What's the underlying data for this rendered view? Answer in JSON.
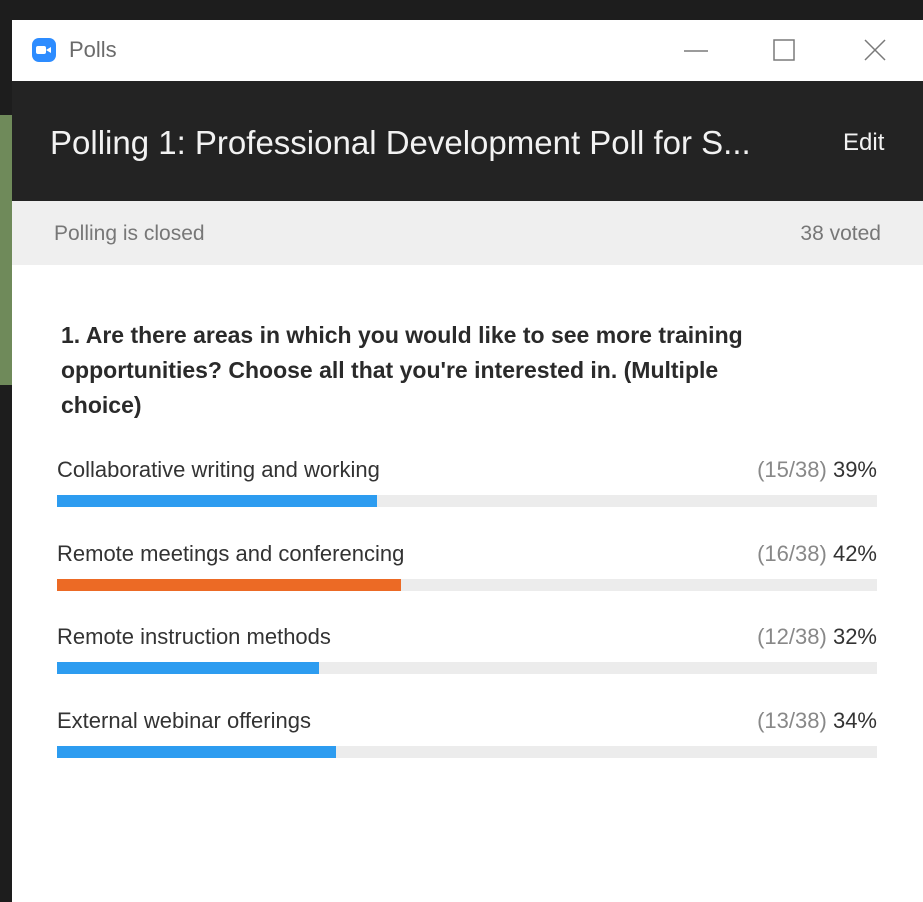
{
  "window": {
    "title": "Polls",
    "app_icon": "zoom-camera-icon",
    "buttons": [
      "minimize-icon",
      "maximize-icon",
      "close-icon"
    ]
  },
  "header": {
    "title": "Polling 1: Professional Development Poll for S...",
    "edit_label": "Edit"
  },
  "status": {
    "text": "Polling is closed",
    "voted": "38 voted"
  },
  "question": {
    "lines": [
      "1. Are there areas in which you would like to see more training",
      "opportunities? Choose all that you're interested in. (Multiple",
      "choice)"
    ]
  },
  "answers": [
    {
      "label": "Collaborative writing and working",
      "count": "(15/38)",
      "percent": "39%",
      "fraction": 0.39,
      "color": "#2d9cf0"
    },
    {
      "label": "Remote meetings and conferencing",
      "count": "(16/38)",
      "percent": "42%",
      "fraction": 0.42,
      "color": "#ec6a25"
    },
    {
      "label": "Remote instruction methods",
      "count": "(12/38)",
      "percent": "32%",
      "fraction": 0.32,
      "color": "#2d9cf0"
    },
    {
      "label": "External webinar offerings",
      "count": "(13/38)",
      "percent": "34%",
      "fraction": 0.34,
      "color": "#2d9cf0"
    }
  ],
  "colors": {
    "header_bg": "#232323",
    "status_bg": "#efefef",
    "accent_blue": "#2d9cf0",
    "accent_orange": "#ec6a25"
  }
}
